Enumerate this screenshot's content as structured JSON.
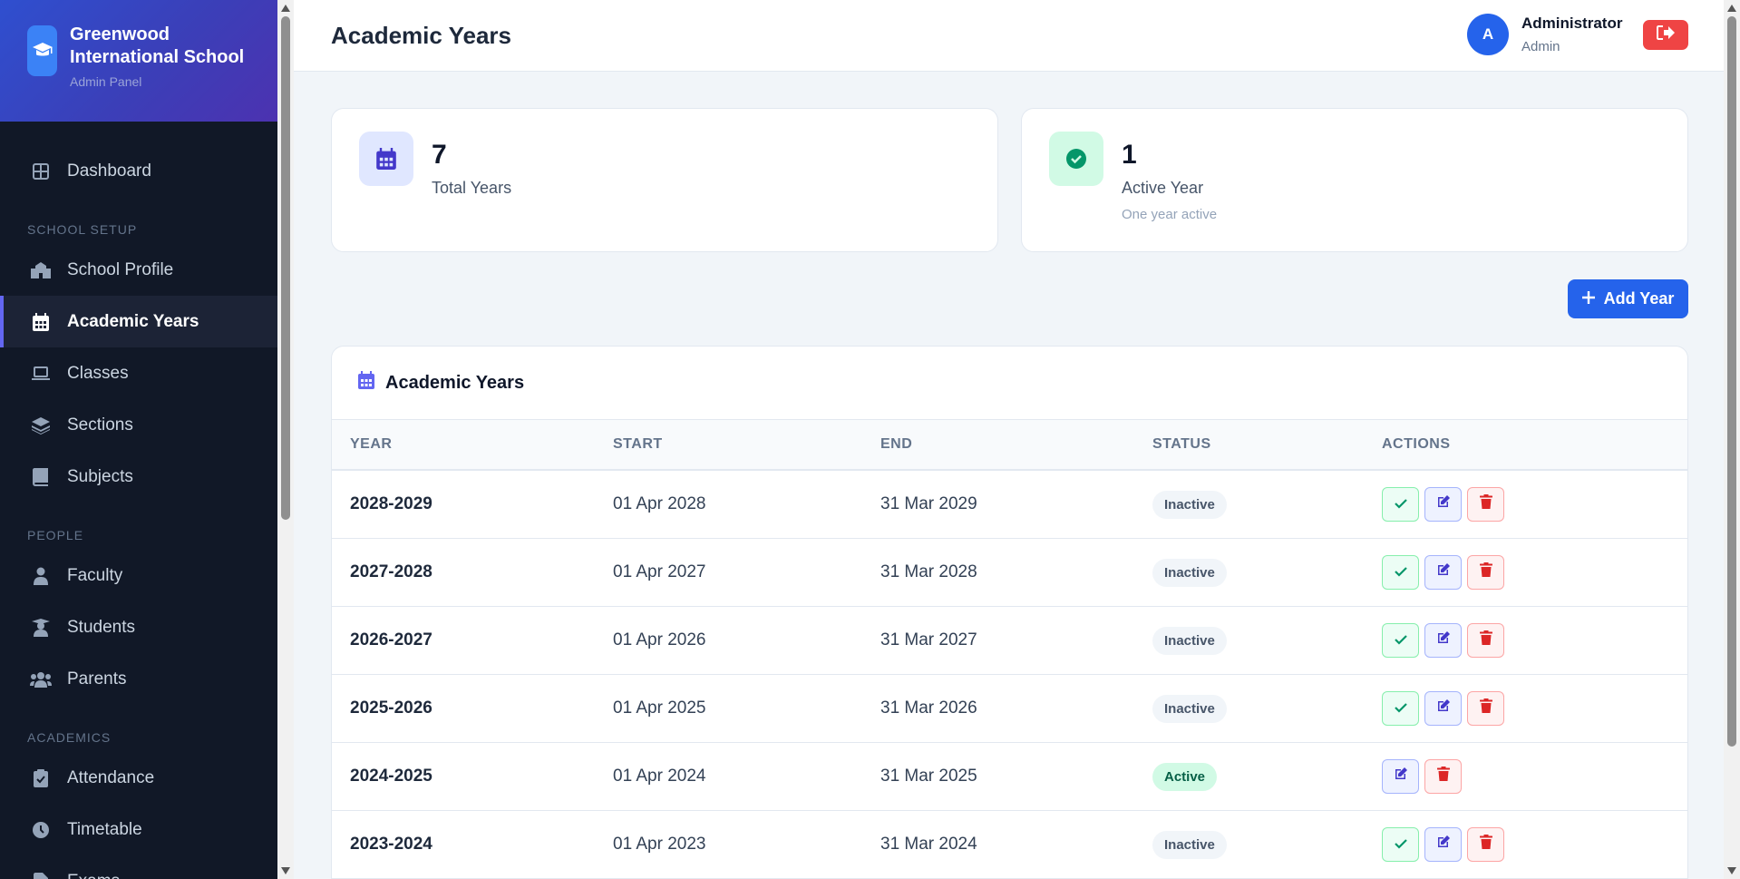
{
  "app": {
    "school_name": "Greenwood International School",
    "panel_label": "Admin Panel"
  },
  "sidebar": {
    "items": [
      {
        "label": "Dashboard",
        "icon": "dashboard-icon"
      },
      {
        "section": "SCHOOL SETUP"
      },
      {
        "label": "School Profile",
        "icon": "school-icon"
      },
      {
        "label": "Academic Years",
        "icon": "calendar-icon",
        "active": true
      },
      {
        "label": "Classes",
        "icon": "laptop-icon"
      },
      {
        "label": "Sections",
        "icon": "layers-icon"
      },
      {
        "label": "Subjects",
        "icon": "book-icon"
      },
      {
        "section": "PEOPLE"
      },
      {
        "label": "Faculty",
        "icon": "teacher-icon"
      },
      {
        "label": "Students",
        "icon": "student-icon"
      },
      {
        "label": "Parents",
        "icon": "users-icon"
      },
      {
        "section": "ACADEMICS"
      },
      {
        "label": "Attendance",
        "icon": "clipboard-check-icon"
      },
      {
        "label": "Timetable",
        "icon": "clock-icon"
      },
      {
        "label": "Exams",
        "icon": "file-icon"
      }
    ]
  },
  "header": {
    "title": "Academic Years",
    "user_initial": "A",
    "user_name": "Administrator",
    "user_role": "Admin"
  },
  "stats": [
    {
      "value": "7",
      "label": "Total Years",
      "note": ""
    },
    {
      "value": "1",
      "label": "Active Year",
      "note": "One year active"
    }
  ],
  "add_button_label": "Add Year",
  "table": {
    "title": "Academic Years",
    "columns": [
      "YEAR",
      "START",
      "END",
      "STATUS",
      "ACTIONS"
    ],
    "rows": [
      {
        "year": "2028-2029",
        "start": "01 Apr 2028",
        "end": "31 Mar 2029",
        "status": "Inactive"
      },
      {
        "year": "2027-2028",
        "start": "01 Apr 2027",
        "end": "31 Mar 2028",
        "status": "Inactive"
      },
      {
        "year": "2026-2027",
        "start": "01 Apr 2026",
        "end": "31 Mar 2027",
        "status": "Inactive"
      },
      {
        "year": "2025-2026",
        "start": "01 Apr 2025",
        "end": "31 Mar 2026",
        "status": "Inactive"
      },
      {
        "year": "2024-2025",
        "start": "01 Apr 2024",
        "end": "31 Mar 2025",
        "status": "Active"
      },
      {
        "year": "2023-2024",
        "start": "01 Apr 2023",
        "end": "31 Mar 2024",
        "status": "Inactive"
      }
    ]
  },
  "colors": {
    "primary": "#2563eb",
    "sidebar_bg": "#111827",
    "accent": "#6366f1",
    "danger": "#ef4444",
    "success": "#059669"
  }
}
